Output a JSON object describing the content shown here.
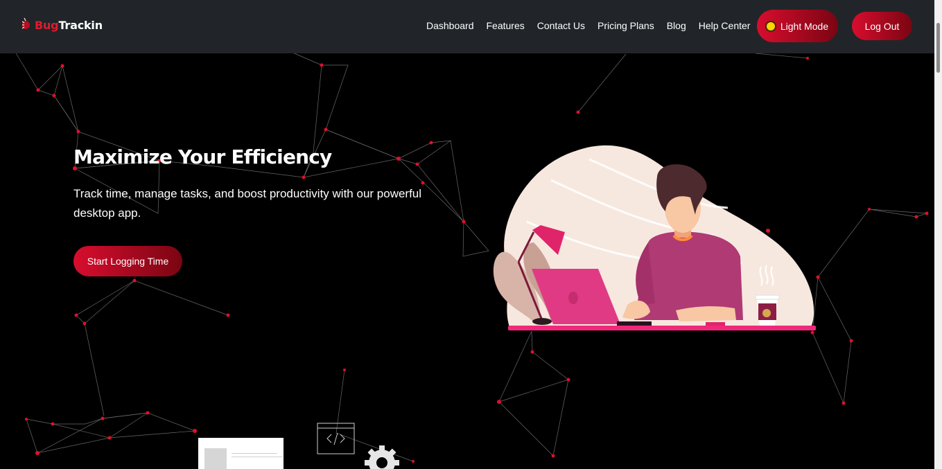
{
  "brand": {
    "name_red": "Bug",
    "name_white": "Trackin"
  },
  "nav": {
    "links": [
      "Dashboard",
      "Features",
      "Contact Us",
      "Pricing Plans",
      "Blog",
      "Help Center"
    ],
    "light_mode_label": "Light Mode",
    "logout_label": "Log Out"
  },
  "hero": {
    "title": "Maximize Your Efficiency",
    "subtitle": "Track time, manage tasks, and boost productivity with our powerful desktop app.",
    "cta_label": "Start Logging Time"
  },
  "icons": [
    "bug-logo-icon",
    "sun-icon",
    "code-window-icon",
    "gear-icon",
    "desk-worker-illustration"
  ],
  "colors": {
    "navbar": "#212529",
    "accent": "#d80d2e",
    "accent_dark": "#7a0512",
    "node": "#e0102a",
    "background": "#000000"
  }
}
